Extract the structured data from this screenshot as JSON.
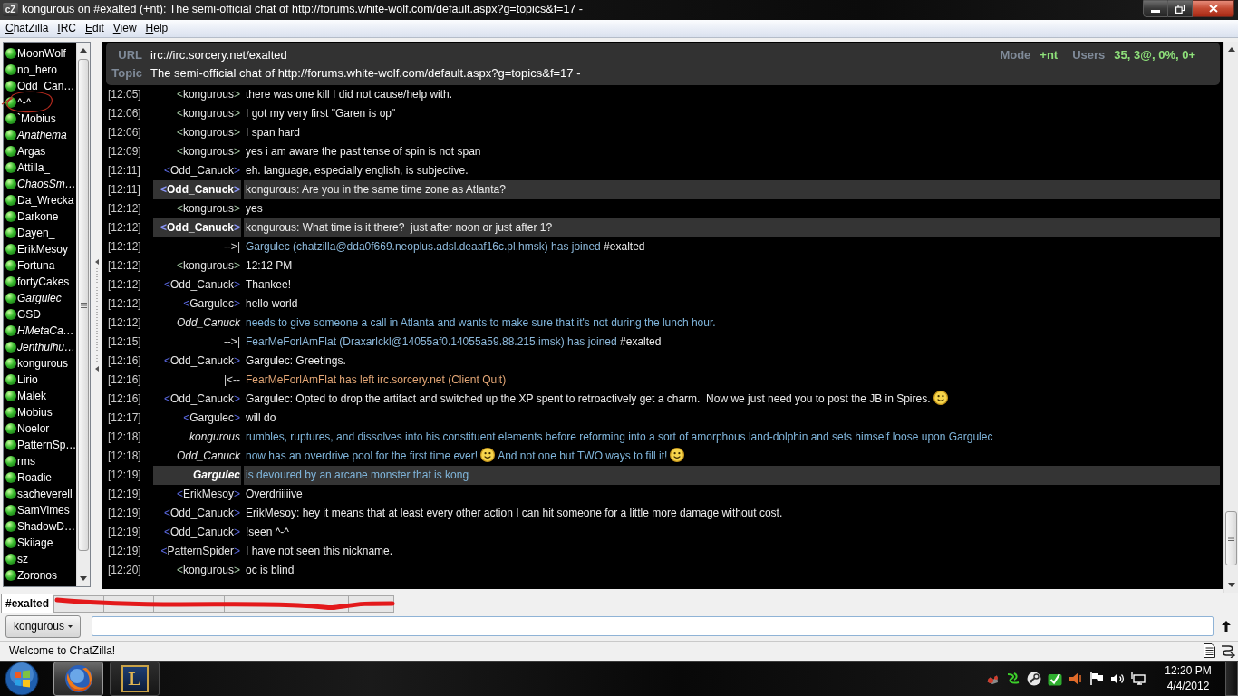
{
  "window": {
    "badge": "cZ",
    "title": "kongurous on #exalted (+nt): The semi-official chat of http://forums.white-wolf.com/default.aspx?g=topics&f=17 -"
  },
  "menu": [
    "ChatZilla",
    "IRC",
    "Edit",
    "View",
    "Help"
  ],
  "users": [
    {
      "name": "MoonWolf",
      "away": false,
      "circled": false
    },
    {
      "name": "no_hero",
      "away": false,
      "circled": false
    },
    {
      "name": "Odd_Can…",
      "away": false,
      "circled": false
    },
    {
      "name": "^-^",
      "away": false,
      "circled": true
    },
    {
      "name": "`Mobius",
      "away": false,
      "circled": false
    },
    {
      "name": "Anathema",
      "away": true,
      "circled": false
    },
    {
      "name": "Argas",
      "away": false,
      "circled": false
    },
    {
      "name": "Attilla_",
      "away": false,
      "circled": false
    },
    {
      "name": "ChaosSm…",
      "away": true,
      "circled": false
    },
    {
      "name": "Da_Wrecka",
      "away": false,
      "circled": false
    },
    {
      "name": "Darkone",
      "away": false,
      "circled": false
    },
    {
      "name": "Dayen_",
      "away": false,
      "circled": false
    },
    {
      "name": "ErikMesoy",
      "away": false,
      "circled": false
    },
    {
      "name": "Fortuna",
      "away": false,
      "circled": false
    },
    {
      "name": "fortyCakes",
      "away": false,
      "circled": false
    },
    {
      "name": "Gargulec",
      "away": true,
      "circled": false
    },
    {
      "name": "GSD",
      "away": false,
      "circled": false
    },
    {
      "name": "HMetaCa…",
      "away": true,
      "circled": false
    },
    {
      "name": "Jenthulhu…",
      "away": true,
      "circled": false
    },
    {
      "name": "kongurous",
      "away": false,
      "circled": false
    },
    {
      "name": "Lirio",
      "away": false,
      "circled": false
    },
    {
      "name": "Malek",
      "away": false,
      "circled": false
    },
    {
      "name": "Mobius",
      "away": false,
      "circled": false
    },
    {
      "name": "Noelor",
      "away": false,
      "circled": false
    },
    {
      "name": "PatternSp…",
      "away": false,
      "circled": false
    },
    {
      "name": "rms",
      "away": false,
      "circled": false
    },
    {
      "name": "Roadie",
      "away": false,
      "circled": false
    },
    {
      "name": "sacheverell",
      "away": false,
      "circled": false
    },
    {
      "name": "SamVimes",
      "away": false,
      "circled": false
    },
    {
      "name": "ShadowD…",
      "away": false,
      "circled": false
    },
    {
      "name": "Skiiage",
      "away": false,
      "circled": false
    },
    {
      "name": "sz",
      "away": false,
      "circled": false
    },
    {
      "name": "Zoronos",
      "away": false,
      "circled": false
    }
  ],
  "header": {
    "url_label": "URL",
    "url": "irc://irc.sorcery.net/exalted",
    "topic_label": "Topic",
    "topic": "The semi-official chat of http://forums.white-wolf.com/default.aspx?g=topics&f=17 -",
    "mode_label": "Mode",
    "mode": "+nt",
    "users_label": "Users",
    "users": "35, 3@, 0%, 0+"
  },
  "messages": [
    {
      "time": "[12:05]",
      "kind": "message",
      "highlighted": false,
      "open": "<",
      "nick": "kongurous",
      "close": ">",
      "self": true,
      "text": "there was one kill I did not cause/help with."
    },
    {
      "time": "[12:06]",
      "kind": "message",
      "highlighted": false,
      "open": "<",
      "nick": "kongurous",
      "close": ">",
      "self": true,
      "text": "I got my very first \"Garen is op\""
    },
    {
      "time": "[12:06]",
      "kind": "message",
      "highlighted": false,
      "open": "<",
      "nick": "kongurous",
      "close": ">",
      "self": true,
      "text": "I span hard"
    },
    {
      "time": "[12:09]",
      "kind": "message",
      "highlighted": false,
      "open": "<",
      "nick": "kongurous",
      "close": ">",
      "self": true,
      "text": "yes i am aware the past tense of spin is not span"
    },
    {
      "time": "[12:11]",
      "kind": "message",
      "highlighted": false,
      "open": "<",
      "nick": "Odd_Canuck",
      "close": ">",
      "self": false,
      "text": "eh. language, especially english, is subjective."
    },
    {
      "time": "[12:11]",
      "kind": "message",
      "highlighted": true,
      "open": "<",
      "nick": "Odd_Canuck",
      "close": ">",
      "self": false,
      "text": "kongurous: Are you in the same time zone as Atlanta?"
    },
    {
      "time": "[12:12]",
      "kind": "message",
      "highlighted": false,
      "open": "<",
      "nick": "kongurous",
      "close": ">",
      "self": true,
      "text": "yes"
    },
    {
      "time": "[12:12]",
      "kind": "message",
      "highlighted": true,
      "open": "<",
      "nick": "Odd_Canuck",
      "close": ">",
      "self": false,
      "text": "kongurous: What time is it there?  just after noon or just after 1?"
    },
    {
      "time": "[12:12]",
      "kind": "join",
      "highlighted": false,
      "marker": "-->|",
      "text": "Gargulec (chatzilla@dda0f669.neoplus.adsl.deaaf16c.pl.hmsk) has joined",
      "channel": "#exalted"
    },
    {
      "time": "[12:12]",
      "kind": "message",
      "highlighted": false,
      "open": "<",
      "nick": "kongurous",
      "close": ">",
      "self": true,
      "text": "12:12 PM"
    },
    {
      "time": "[12:12]",
      "kind": "message",
      "highlighted": false,
      "open": "<",
      "nick": "Odd_Canuck",
      "close": ">",
      "self": false,
      "text": "Thankee!"
    },
    {
      "time": "[12:12]",
      "kind": "message",
      "highlighted": false,
      "open": "<",
      "nick": "Gargulec",
      "close": ">",
      "self": false,
      "text": "hello world"
    },
    {
      "time": "[12:12]",
      "kind": "action",
      "highlighted": false,
      "nick": "Odd_Canuck",
      "text": "needs to give someone a call in Atlanta and wants to make sure that it's not during the lunch hour."
    },
    {
      "time": "[12:15]",
      "kind": "join",
      "highlighted": false,
      "marker": "-->|",
      "text": "FearMeForlAmFlat (Draxarlckl@14055af0.14055a59.88.215.imsk) has joined",
      "channel": "#exalted"
    },
    {
      "time": "[12:16]",
      "kind": "message",
      "highlighted": false,
      "open": "<",
      "nick": "Odd_Canuck",
      "close": ">",
      "self": false,
      "text": "Gargulec: Greetings."
    },
    {
      "time": "[12:16]",
      "kind": "quit",
      "highlighted": false,
      "marker": "|<--",
      "text": "FearMeForlAmFlat has left irc.sorcery.net (Client Quit)"
    },
    {
      "time": "[12:16]",
      "kind": "message",
      "highlighted": false,
      "open": "<",
      "nick": "Odd_Canuck",
      "close": ">",
      "self": false,
      "parts": [
        {
          "kind": "text",
          "text": "Gargulec: Opted to drop the artifact and switched up the XP spent to retroactively get a charm.  Now we just need you to post the JB in Spires."
        },
        {
          "kind": "smiley"
        }
      ]
    },
    {
      "time": "[12:17]",
      "kind": "message",
      "highlighted": false,
      "open": "<",
      "nick": "Gargulec",
      "close": ">",
      "self": false,
      "text": "will do"
    },
    {
      "time": "[12:18]",
      "kind": "action",
      "highlighted": false,
      "nick": "kongurous",
      "text": "rumbles, ruptures, and dissolves into his constituent elements before reforming into a sort of amorphous land-dolphin and sets himself loose upon Gargulec"
    },
    {
      "time": "[12:18]",
      "kind": "action",
      "highlighted": false,
      "nick": "Odd_Canuck",
      "parts": [
        {
          "kind": "text",
          "text": "now has an overdrive pool for the first time ever!"
        },
        {
          "kind": "smiley"
        },
        {
          "kind": "text",
          "text": "And not one but TWO ways to fill it!"
        },
        {
          "kind": "smiley"
        }
      ]
    },
    {
      "time": "[12:19]",
      "kind": "action",
      "highlighted": true,
      "nick": "Gargulec",
      "text": "is devoured by an arcane monster that is kong"
    },
    {
      "time": "[12:19]",
      "kind": "message",
      "highlighted": false,
      "open": "<",
      "nick": "ErikMesoy",
      "close": ">",
      "self": false,
      "text": "Overdriiiiive"
    },
    {
      "time": "[12:19]",
      "kind": "message",
      "highlighted": false,
      "open": "<",
      "nick": "Odd_Canuck",
      "close": ">",
      "self": false,
      "text": "ErikMesoy: hey it means that at least every other action I can hit someone for a little more damage without cost."
    },
    {
      "time": "[12:19]",
      "kind": "message",
      "highlighted": false,
      "open": "<",
      "nick": "Odd_Canuck",
      "close": ">",
      "self": false,
      "text": "!seen ^-^"
    },
    {
      "time": "[12:19]",
      "kind": "message",
      "highlighted": false,
      "open": "<",
      "nick": "PatternSpider",
      "close": ">",
      "self": false,
      "text": "I have not seen this nickname."
    },
    {
      "time": "[12:20]",
      "kind": "message",
      "highlighted": false,
      "open": "<",
      "nick": "kongurous",
      "close": ">",
      "self": true,
      "text": "oc is blind"
    }
  ],
  "tab_bar": {
    "tabs": [
      {
        "label": "#exalted",
        "selected": true
      }
    ],
    "scribbled": true
  },
  "input": {
    "nick": "kongurous"
  },
  "status_bar": {
    "text": "Welcome to ChatZilla!"
  },
  "taskbar": {
    "apps": [
      {
        "kind": "browser",
        "selected": true
      },
      {
        "kind": "game",
        "logo": "L",
        "selected": false
      }
    ],
    "clock": {
      "time": "12:20 PM",
      "date": "4/4/2012"
    }
  }
}
